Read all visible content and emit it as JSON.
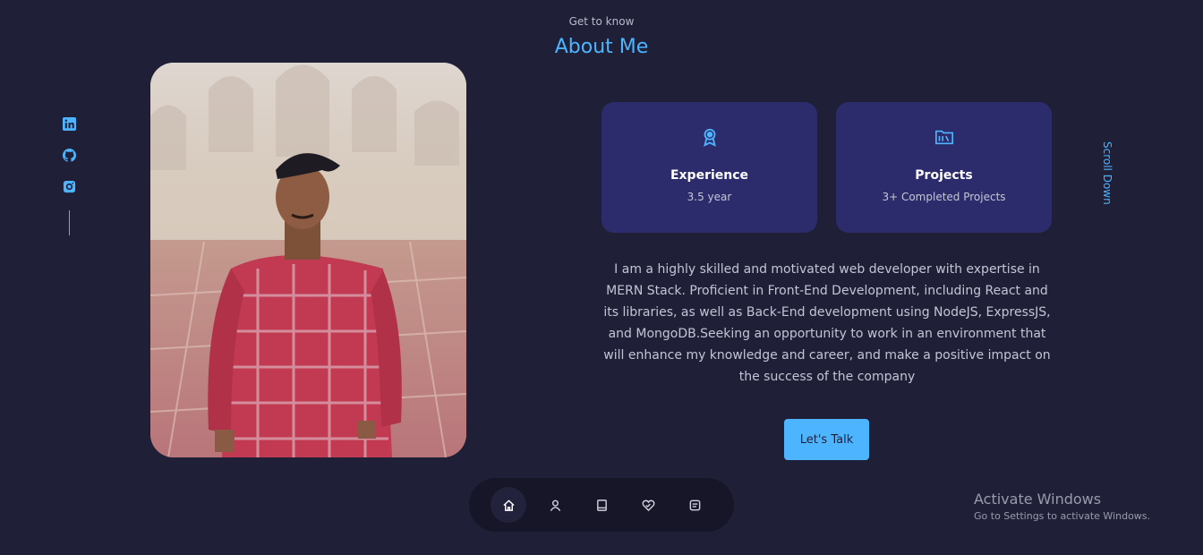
{
  "header": {
    "subtitle": "Get to know",
    "title": "About Me"
  },
  "socials": [
    {
      "name": "linkedin",
      "icon": "linkedin-icon"
    },
    {
      "name": "github",
      "icon": "github-icon"
    },
    {
      "name": "instagram",
      "icon": "instagram-icon"
    }
  ],
  "cards": {
    "experience": {
      "icon": "award-icon",
      "title": "Experience",
      "subtitle": "3.5 year"
    },
    "projects": {
      "icon": "folder-icon",
      "title": "Projects",
      "subtitle": "3+ Completed Projects"
    }
  },
  "about_text": "I am a highly skilled and motivated web developer with expertise in MERN Stack. Proficient in Front-End Development, including React and its libraries, as well as Back-End development using NodeJS, ExpressJS, and MongoDB.Seeking an opportunity to work in an environment that will enhance my knowledge and career, and make a positive impact on the success of the company",
  "cta_label": "Let's Talk",
  "scroll_label": "Scroll Down",
  "nav": [
    {
      "icon": "home-icon",
      "active": true
    },
    {
      "icon": "user-icon",
      "active": false
    },
    {
      "icon": "book-icon",
      "active": false
    },
    {
      "icon": "services-icon",
      "active": false
    },
    {
      "icon": "message-icon",
      "active": false
    }
  ],
  "watermark": {
    "title": "Activate Windows",
    "subtitle": "Go to Settings to activate Windows."
  },
  "colors": {
    "background": "#1f1f38",
    "accent": "#4db5ff",
    "card": "#2c2c6c",
    "nav_background": "#161628"
  }
}
